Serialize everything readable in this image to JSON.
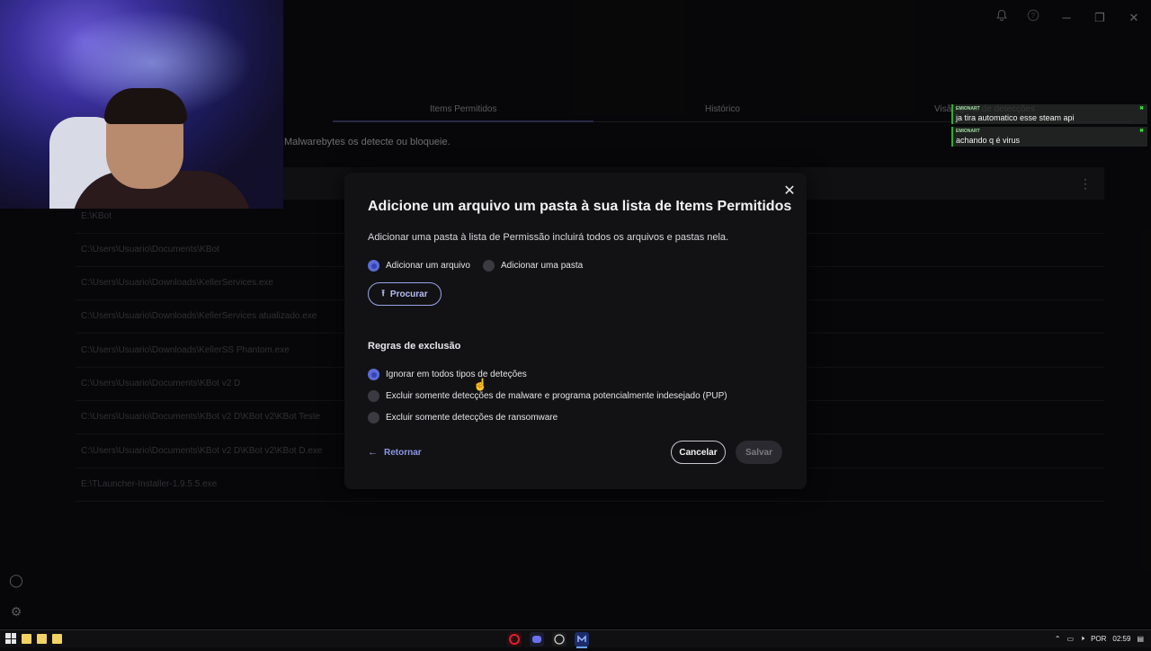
{
  "tabs": [
    {
      "label": "Items Permitidos"
    },
    {
      "label": "Histórico"
    },
    {
      "label": "Visão geral de detecções"
    }
  ],
  "page": {
    "description": "Malwarebytes os detecte ou bloqueie."
  },
  "list_rows": [
    "E:\\KBot",
    "C:\\Users\\Usuario\\Documents\\KBot",
    "C:\\Users\\Usuario\\Downloads\\KellerServices.exe",
    "C:\\Users\\Usuario\\Downloads\\KellerServices atualizado.exe",
    "C:\\Users\\Usuario\\Downloads\\KellerSS Phantom.exe",
    "C:\\Users\\Usuario\\Documents\\KBot v2 D",
    "C:\\Users\\Usuario\\Documents\\KBot v2 D\\KBot v2\\KBot Teste",
    "C:\\Users\\Usuario\\Documents\\KBot v2 D\\KBot v2\\KBot D.exe",
    "E:\\TLauncher-Installer-1.9.5.5.exe"
  ],
  "modal": {
    "title": "Adicione um arquivo um pasta à sua lista de Items Permitidos",
    "subtitle": "Adicionar uma pasta à lista de Permissão incluirá todos os arquivos e pastas nela.",
    "type_options": [
      {
        "label": "Adicionar um arquivo",
        "selected": true
      },
      {
        "label": "Adicionar uma pasta",
        "selected": false
      }
    ],
    "browse_label": "Procurar",
    "rules_title": "Regras de exclusão",
    "rules": [
      {
        "label": "Ignorar em todos tipos de deteções",
        "selected": true
      },
      {
        "label": "Excluir somente detecções de malware e programa potencialmente indesejado (PUP)",
        "selected": false
      },
      {
        "label": "Excluir somente detecções de ransomware",
        "selected": false
      }
    ],
    "back_label": "Retornar",
    "cancel_label": "Cancelar",
    "save_label": "Salvar"
  },
  "chat": [
    {
      "user": "EMIONART",
      "message": "ja tira automatico esse steam api"
    },
    {
      "user": "EMIONART",
      "message": "achando q é virus"
    }
  ],
  "taskbar": {
    "language": "POR",
    "time": "02:59"
  },
  "colors": {
    "accent": "#5c6ad6",
    "link": "#8d96e6",
    "modal_bg": "#121214",
    "page_bg": "#0c0c0e"
  }
}
